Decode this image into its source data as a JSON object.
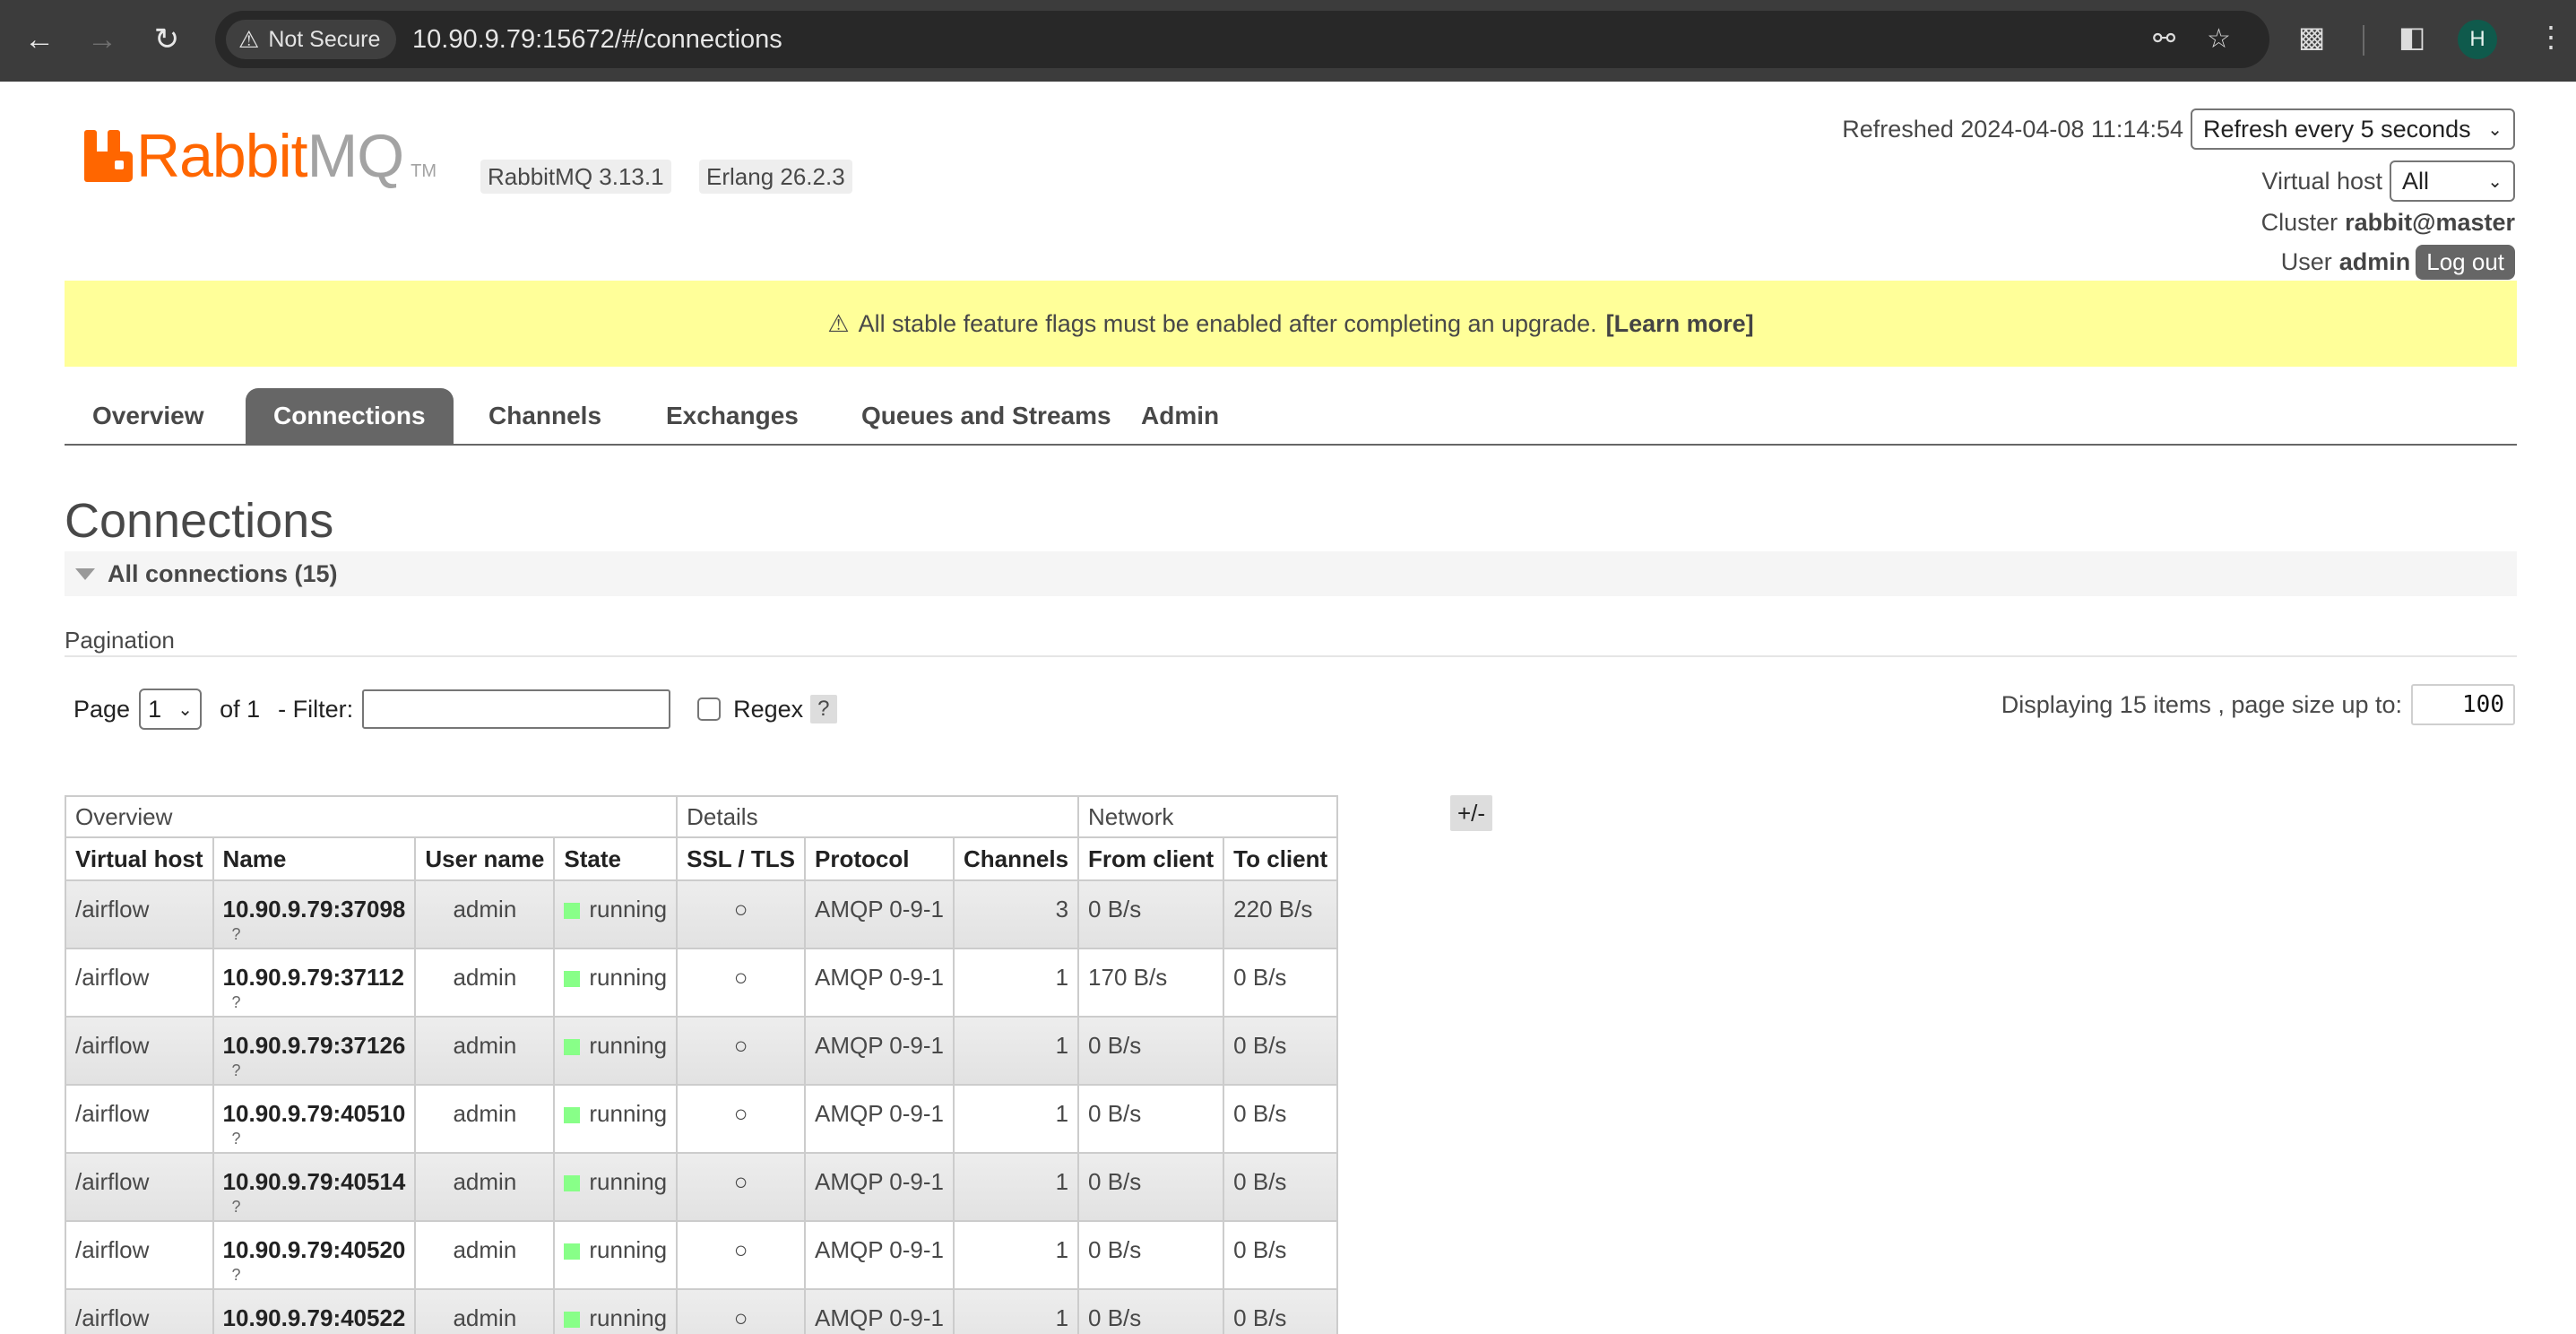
{
  "browser": {
    "security_label": "Not Secure",
    "url": "10.90.9.79:15672/#/connections",
    "profile_initial": "H"
  },
  "header": {
    "logo_rabbit": "Rabbit",
    "logo_mq": "MQ",
    "logo_tm": "TM",
    "version": "RabbitMQ 3.13.1",
    "erlang": "Erlang 26.2.3",
    "refreshed_label": "Refreshed 2024-04-08 11:14:54",
    "refresh_select": "Refresh every 5 seconds",
    "vhost_label": "Virtual host",
    "vhost_value": "All",
    "cluster_label": "Cluster",
    "cluster_value": "rabbit@master",
    "user_label": "User",
    "user_value": "admin",
    "logout_label": "Log out"
  },
  "banner": {
    "icon": "⚠",
    "text": "All stable feature flags must be enabled after completing an upgrade.",
    "link": "[Learn more]"
  },
  "tabs": [
    "Overview",
    "Connections",
    "Channels",
    "Exchanges",
    "Queues and Streams",
    "Admin"
  ],
  "main": {
    "title": "Connections",
    "section": "All connections (15)",
    "pagination_label": "Pagination",
    "page_label": "Page",
    "page_value": "1",
    "of_label": "of 1",
    "filter_label": "- Filter:",
    "regex_label": "Regex",
    "help": "?",
    "displaying": "Displaying 15 items , page size up to:",
    "page_size": "100",
    "plus_minus": "+/-"
  },
  "table": {
    "groups": [
      "Overview",
      "Details",
      "Network"
    ],
    "columns": [
      "Virtual host",
      "Name",
      "User name",
      "State",
      "SSL / TLS",
      "Protocol",
      "Channels",
      "From client",
      "To client"
    ],
    "rows": [
      {
        "vhost": "/airflow",
        "name": "10.90.9.79:37098",
        "sub": "?",
        "user": "admin",
        "state": "running",
        "ssl": "○",
        "protocol": "AMQP 0-9-1",
        "channels": "3",
        "from": "0 B/s",
        "to": "220 B/s"
      },
      {
        "vhost": "/airflow",
        "name": "10.90.9.79:37112",
        "sub": "?",
        "user": "admin",
        "state": "running",
        "ssl": "○",
        "protocol": "AMQP 0-9-1",
        "channels": "1",
        "from": "170 B/s",
        "to": "0 B/s"
      },
      {
        "vhost": "/airflow",
        "name": "10.90.9.79:37126",
        "sub": "?",
        "user": "admin",
        "state": "running",
        "ssl": "○",
        "protocol": "AMQP 0-9-1",
        "channels": "1",
        "from": "0 B/s",
        "to": "0 B/s"
      },
      {
        "vhost": "/airflow",
        "name": "10.90.9.79:40510",
        "sub": "?",
        "user": "admin",
        "state": "running",
        "ssl": "○",
        "protocol": "AMQP 0-9-1",
        "channels": "1",
        "from": "0 B/s",
        "to": "0 B/s"
      },
      {
        "vhost": "/airflow",
        "name": "10.90.9.79:40514",
        "sub": "?",
        "user": "admin",
        "state": "running",
        "ssl": "○",
        "protocol": "AMQP 0-9-1",
        "channels": "1",
        "from": "0 B/s",
        "to": "0 B/s"
      },
      {
        "vhost": "/airflow",
        "name": "10.90.9.79:40520",
        "sub": "?",
        "user": "admin",
        "state": "running",
        "ssl": "○",
        "protocol": "AMQP 0-9-1",
        "channels": "1",
        "from": "0 B/s",
        "to": "0 B/s"
      },
      {
        "vhost": "/airflow",
        "name": "10.90.9.79:40522",
        "sub": "?",
        "user": "admin",
        "state": "running",
        "ssl": "○",
        "protocol": "AMQP 0-9-1",
        "channels": "1",
        "from": "0 B/s",
        "to": "0 B/s"
      }
    ]
  },
  "colors": {
    "brand_orange": "#ff6600",
    "banner_yellow": "#ffff99",
    "running_green": "#88ff88",
    "tab_active": "#666666"
  }
}
